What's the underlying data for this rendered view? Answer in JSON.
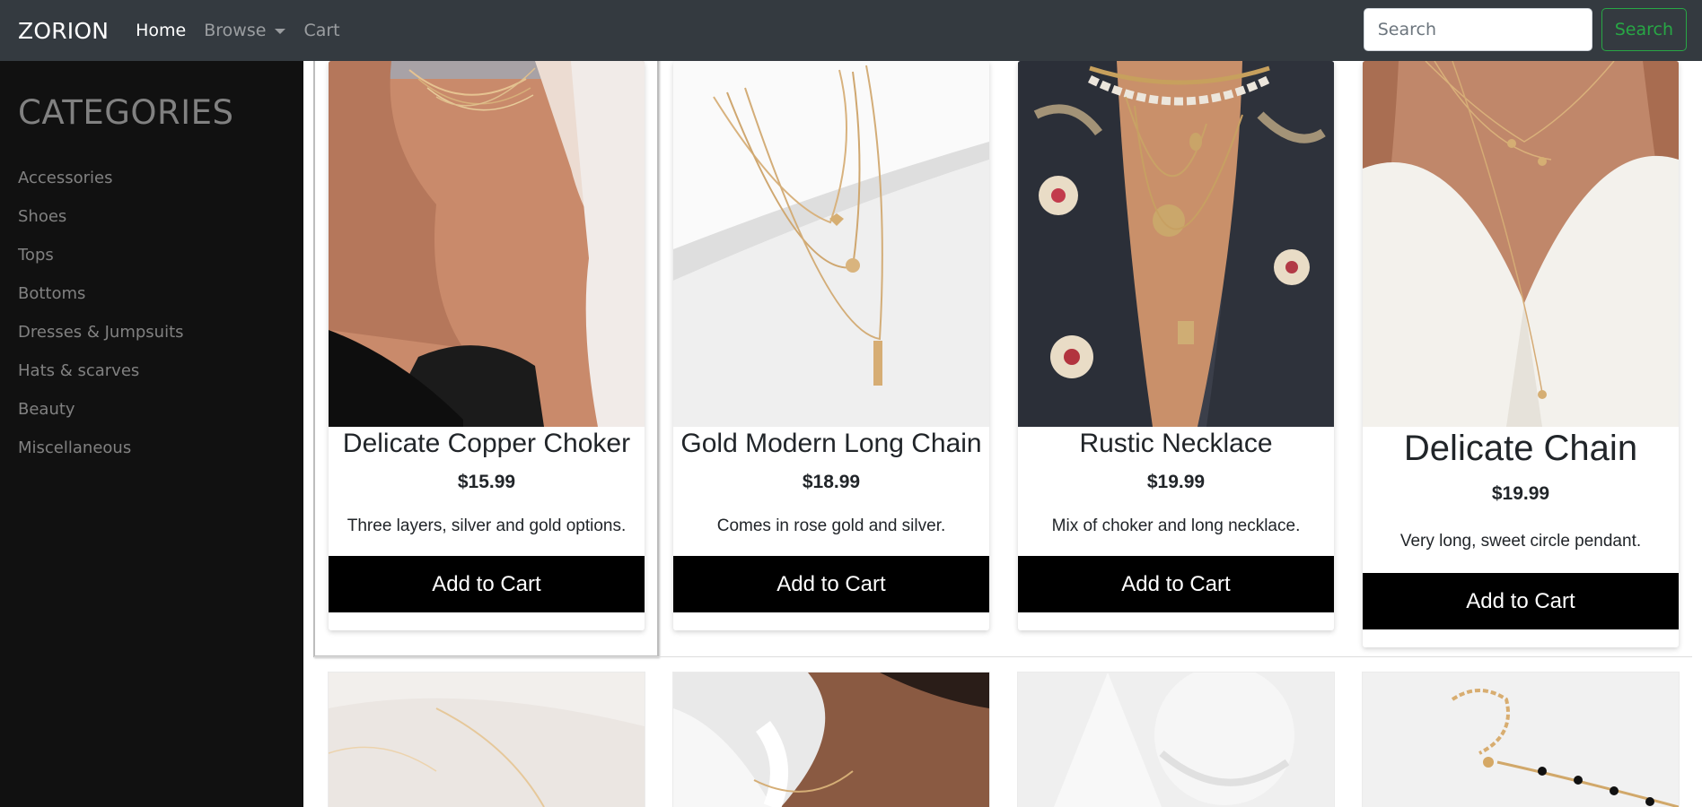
{
  "navbar": {
    "brand": "ZORION",
    "links": [
      {
        "label": "Home",
        "active": true
      },
      {
        "label": "Browse",
        "dropdown": true
      },
      {
        "label": "Cart"
      }
    ],
    "search_placeholder": "Search",
    "search_button": "Search",
    "colors": {
      "bar": "#343a40",
      "search_button": "#28a745"
    }
  },
  "sidebar": {
    "title": "CATEGORIES",
    "items": [
      {
        "label": "Accessories"
      },
      {
        "label": "Shoes"
      },
      {
        "label": "Tops"
      },
      {
        "label": "Bottoms"
      },
      {
        "label": "Dresses & Jumpsuits"
      },
      {
        "label": "Hats & scarves"
      },
      {
        "label": "Beauty"
      },
      {
        "label": "Miscellaneous"
      }
    ]
  },
  "products": [
    {
      "title": "Delicate Copper Choker",
      "price": "$15.99",
      "desc": "Three layers, silver and gold options.",
      "button": "Add to Cart"
    },
    {
      "title": "Gold Modern Long Chain",
      "price": "$18.99",
      "desc": "Comes in rose gold and silver.",
      "button": "Add to Cart"
    },
    {
      "title": "Rustic Necklace",
      "price": "$19.99",
      "desc": "Mix of choker and long necklace.",
      "button": "Add to Cart"
    },
    {
      "title": "Delicate Chain",
      "price": "$19.99",
      "desc": "Very long, sweet circle pendant.",
      "button": "Add to Cart"
    }
  ]
}
